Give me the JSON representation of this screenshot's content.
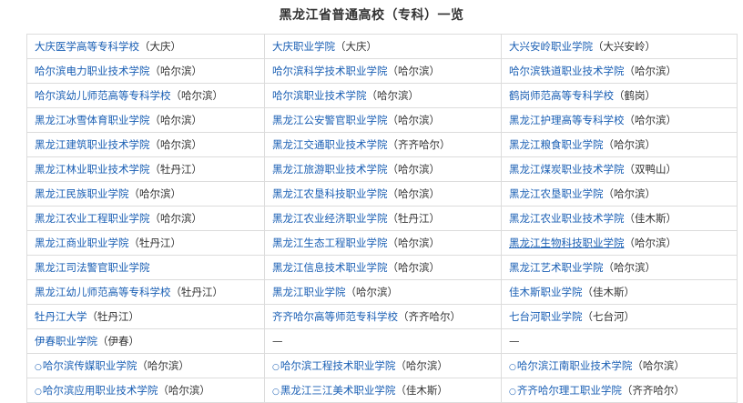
{
  "title": "黑龙江省普通高校（专科）一览",
  "rows": [
    [
      {
        "name": "大庆医学高等专科学校",
        "city": "（大庆）"
      },
      {
        "name": "大庆职业学院",
        "city": "（大庆）"
      },
      {
        "name": "大兴安岭职业学院",
        "city": "（大兴安岭）"
      }
    ],
    [
      {
        "name": "哈尔滨电力职业技术学院",
        "city": "（哈尔滨）"
      },
      {
        "name": "哈尔滨科学技术职业学院",
        "city": "（哈尔滨）"
      },
      {
        "name": "哈尔滨铁道职业技术学院",
        "city": "（哈尔滨）"
      }
    ],
    [
      {
        "name": "哈尔滨幼儿师范高等专科学校",
        "city": "（哈尔滨）"
      },
      {
        "name": "哈尔滨职业技术学院",
        "city": "（哈尔滨）"
      },
      {
        "name": "鹤岗师范高等专科学校",
        "city": "（鹤岗）"
      }
    ],
    [
      {
        "name": "黑龙江冰雪体育职业学院",
        "city": "（哈尔滨）"
      },
      {
        "name": "黑龙江公安警官职业学院",
        "city": "（哈尔滨）"
      },
      {
        "name": "黑龙江护理高等专科学校",
        "city": "（哈尔滨）"
      }
    ],
    [
      {
        "name": "黑龙江建筑职业技术学院",
        "city": "（哈尔滨）"
      },
      {
        "name": "黑龙江交通职业技术学院",
        "city": "（齐齐哈尔）"
      },
      {
        "name": "黑龙江粮食职业学院",
        "city": "（哈尔滨）"
      }
    ],
    [
      {
        "name": "黑龙江林业职业技术学院",
        "city": "（牡丹江）"
      },
      {
        "name": "黑龙江旅游职业技术学院",
        "city": "（哈尔滨）"
      },
      {
        "name": "黑龙江煤炭职业技术学院",
        "city": "（双鸭山）"
      }
    ],
    [
      {
        "name": "黑龙江民族职业学院",
        "city": "（哈尔滨）"
      },
      {
        "name": "黑龙江农垦科技职业学院",
        "city": "（哈尔滨）"
      },
      {
        "name": "黑龙江农垦职业学院",
        "city": "（哈尔滨）"
      }
    ],
    [
      {
        "name": "黑龙江农业工程职业学院",
        "city": "（哈尔滨）"
      },
      {
        "name": "黑龙江农业经济职业学院",
        "city": "（牡丹江）"
      },
      {
        "name": "黑龙江农业职业技术学院",
        "city": "（佳木斯）"
      }
    ],
    [
      {
        "name": "黑龙江商业职业学院",
        "city": "（牡丹江）"
      },
      {
        "name": "黑龙江生态工程职业学院",
        "city": "（哈尔滨）"
      },
      {
        "name": "黑龙江生物科技职业学院",
        "city": "（哈尔滨）",
        "underline": true
      }
    ],
    [
      {
        "name": "黑龙江司法警官职业学院",
        "city": ""
      },
      {
        "name": "黑龙江信息技术职业学院",
        "city": "（哈尔滨）"
      },
      {
        "name": "黑龙江艺术职业学院",
        "city": "（哈尔滨）"
      }
    ],
    [
      {
        "name": "黑龙江幼儿师范高等专科学校",
        "city": "（牡丹江）"
      },
      {
        "name": "黑龙江职业学院",
        "city": "（哈尔滨）"
      },
      {
        "name": "佳木斯职业学院",
        "city": "（佳木斯）"
      }
    ],
    [
      {
        "name": "牡丹江大学",
        "city": "（牡丹江）"
      },
      {
        "name": "齐齐哈尔高等师范专科学校",
        "city": "（齐齐哈尔）"
      },
      {
        "name": "七台河职业学院",
        "city": "（七台河）"
      }
    ],
    [
      {
        "name": "伊春职业学院",
        "city": "（伊春）"
      },
      {
        "dash": "—"
      },
      {
        "dash": "—"
      }
    ],
    [
      {
        "bullet": "○",
        "name": "哈尔滨传媒职业学院",
        "city": "（哈尔滨）"
      },
      {
        "bullet": "○",
        "name": "哈尔滨工程技术职业学院",
        "city": "（哈尔滨）"
      },
      {
        "bullet": "○",
        "name": "哈尔滨江南职业技术学院",
        "city": "（哈尔滨）"
      }
    ],
    [
      {
        "bullet": "○",
        "name": "哈尔滨应用职业技术学院",
        "city": "（哈尔滨）"
      },
      {
        "bullet": "○",
        "name": "黑龙江三江美术职业学院",
        "city": "（佳木斯）"
      },
      {
        "bullet": "○",
        "name": "齐齐哈尔理工职业学院",
        "city": "（齐齐哈尔）"
      }
    ]
  ]
}
